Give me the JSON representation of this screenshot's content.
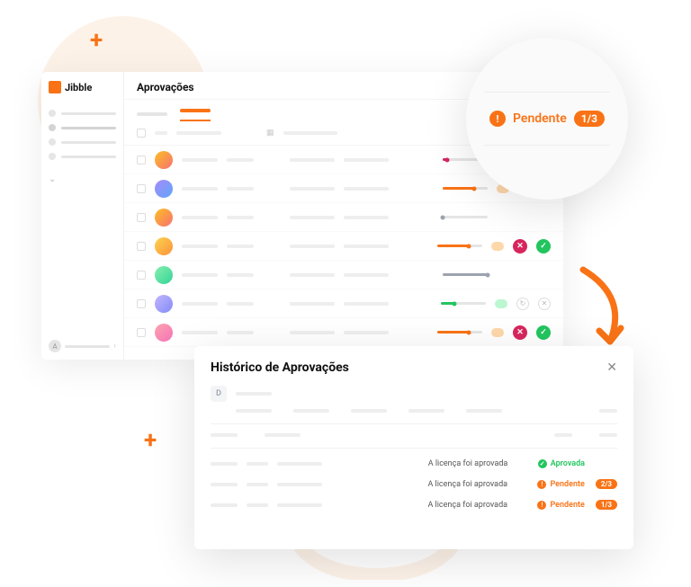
{
  "brand": "Jibble",
  "page_title": "Aprovações",
  "sidebar_footer_letter": "A",
  "zoom": {
    "label": "Pendente",
    "count": "1/3",
    "icon": "!"
  },
  "rows": [
    {
      "variant": "v1",
      "slider_color": "red",
      "slider_pct": 10,
      "badge": null,
      "actions": []
    },
    {
      "variant": "v2",
      "slider_color": "orange",
      "slider_pct": 70,
      "badge": "orange",
      "actions": []
    },
    {
      "variant": "v1",
      "slider_color": "gray",
      "slider_pct": 0,
      "badge": null,
      "actions": []
    },
    {
      "variant": "v3",
      "slider_color": "orange",
      "slider_pct": 70,
      "badge": "orange",
      "actions": [
        "reject",
        "approve"
      ]
    },
    {
      "variant": "v4",
      "slider_color": "gray",
      "slider_pct": 100,
      "badge": null,
      "actions": []
    },
    {
      "variant": "v5",
      "slider_color": "green",
      "slider_pct": 30,
      "badge": "green",
      "actions": [
        "history",
        "close"
      ]
    },
    {
      "variant": "v6",
      "slider_color": "orange",
      "slider_pct": 70,
      "badge": "orange",
      "actions": [
        "reject",
        "approve"
      ]
    }
  ],
  "modal": {
    "title": "Histórico de Aprovações",
    "avatar_letter": "D",
    "history": [
      {
        "msg": "A licença foi aprovada",
        "status": "approved",
        "status_label": "Aprovada",
        "count": ""
      },
      {
        "msg": "A licença foi aprovada",
        "status": "pending",
        "status_label": "Pendente",
        "count": "2/3"
      },
      {
        "msg": "A licença foi aprovada",
        "status": "pending",
        "status_label": "Pendente",
        "count": "1/3"
      }
    ]
  }
}
